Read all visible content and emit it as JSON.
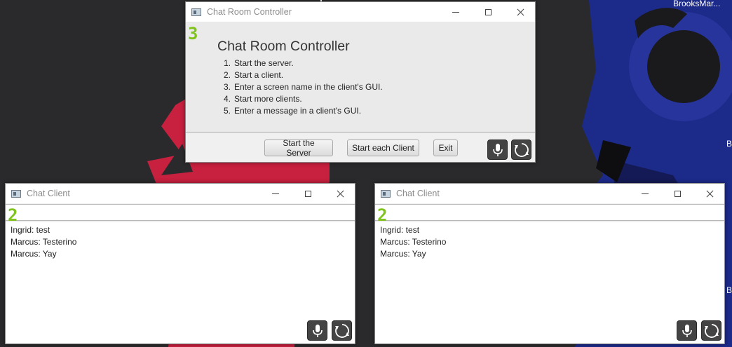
{
  "desktop": {
    "corner_label": "BrooksMar...",
    "edge_letter_1": "B",
    "edge_letter_2": "B"
  },
  "controller": {
    "title": "Chat Room Controller",
    "badge": "3",
    "heading": "Chat Room Controller",
    "steps": [
      {
        "num": "1.",
        "text": "Start the server."
      },
      {
        "num": "2.",
        "text": "Start a client."
      },
      {
        "num": "3.",
        "text": "Enter a screen name in the client's GUI."
      },
      {
        "num": "4.",
        "text": "Start more clients."
      },
      {
        "num": "5.",
        "text": "Enter a message in a client's GUI."
      }
    ],
    "buttons": {
      "start_server": "Start the Server",
      "start_client": "Start each Client",
      "exit": "Exit"
    }
  },
  "clients": [
    {
      "title": "Chat Client",
      "badge": "2",
      "input_value": "",
      "messages": [
        "Ingrid: test",
        "Marcus: Testerino",
        "Marcus: Yay"
      ]
    },
    {
      "title": "Chat Client",
      "badge": "2",
      "input_value": "",
      "messages": [
        "Ingrid: test",
        "Marcus: Testerino",
        "Marcus: Yay"
      ]
    }
  ],
  "icons": {
    "mic": "microphone-icon",
    "refresh": "refresh-icon"
  },
  "colors": {
    "badge_green": "#7fc31c",
    "desktop_dark": "#2b2b2d",
    "wallpaper_red": "#c8203f",
    "wallpaper_blue": "#1c2a8a"
  }
}
